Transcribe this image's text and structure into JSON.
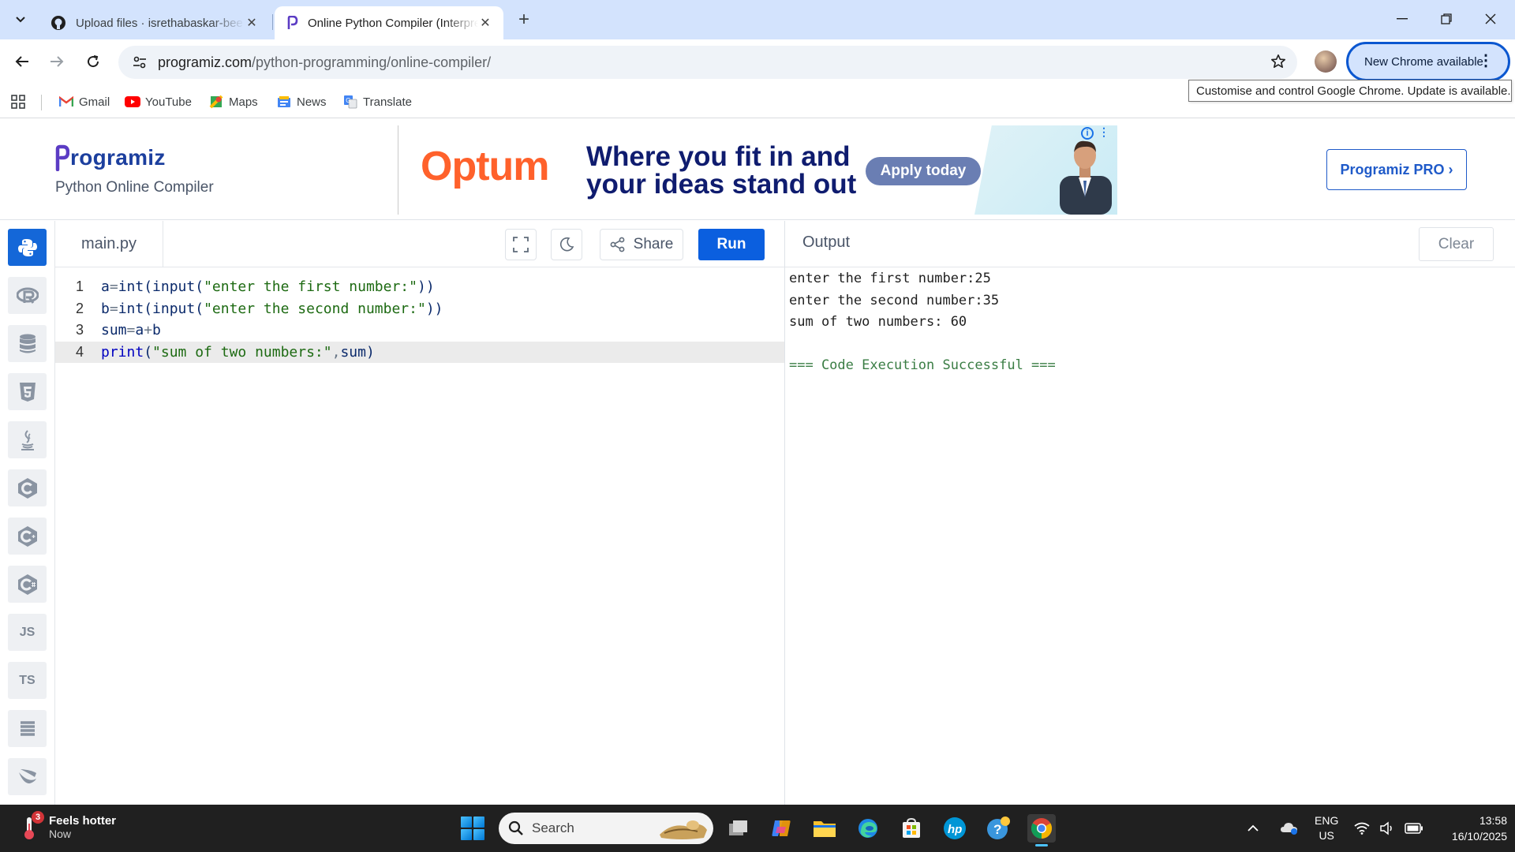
{
  "browser": {
    "tabs": [
      {
        "title": "Upload files · isrethabaskar-bee"
      },
      {
        "title": "Online Python Compiler (Interpreter)"
      }
    ],
    "url_domain": "programiz.com",
    "url_path": "/python-programming/online-compiler/",
    "update_button": "New Chrome available",
    "tooltip": "Customise and control Google Chrome. Update is available."
  },
  "bookmarks": [
    {
      "label": "Gmail",
      "icon": "gmail-icon"
    },
    {
      "label": "YouTube",
      "icon": "youtube-icon"
    },
    {
      "label": "Maps",
      "icon": "maps-icon"
    },
    {
      "label": "News",
      "icon": "news-icon"
    },
    {
      "label": "Translate",
      "icon": "translate-icon"
    }
  ],
  "site": {
    "logo": "rogramiz",
    "subtitle": "Python Online Compiler",
    "pro_button": "Programiz PRO ›"
  },
  "ad": {
    "brand": "Optum",
    "headline": "Where you fit in and your ideas stand out",
    "cta": "Apply today"
  },
  "editor": {
    "file_name": "main.py",
    "share_label": "Share",
    "run_label": "Run",
    "lines": [
      {
        "n": "1",
        "code": "a=int(input(\"enter the first number:\"))"
      },
      {
        "n": "2",
        "code": "b=int(input(\"enter the second number:\"))"
      },
      {
        "n": "3",
        "code": "sum=a+b"
      },
      {
        "n": "4",
        "code": "print(\"sum of two numbers:\",sum)"
      }
    ]
  },
  "output": {
    "title": "Output",
    "clear_label": "Clear",
    "lines": [
      "enter the first number:25",
      "enter the second number:35",
      "sum of two numbers: 60",
      "",
      "=== Code Execution Successful ==="
    ]
  },
  "languages": [
    "python",
    "r",
    "sql",
    "html",
    "java",
    "c",
    "cpp",
    "csharp",
    "JS",
    "TS",
    "go",
    "swift"
  ],
  "taskbar": {
    "weather_title": "Feels hotter",
    "weather_sub": "Now",
    "weather_badge": "3",
    "search_placeholder": "Search",
    "lang_line1": "ENG",
    "lang_line2": "US",
    "time": "13:58",
    "date": "16/10/2025"
  },
  "colors": {
    "accent": "#0b5fdf",
    "brand": "#1c3f9e",
    "success": "#3a7d44"
  }
}
